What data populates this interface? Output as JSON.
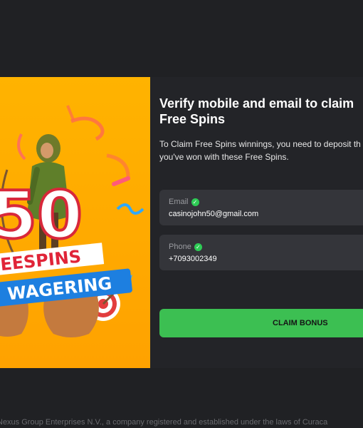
{
  "promo": {
    "number": "50",
    "line1": "EESPINS",
    "line2": "WAGERING"
  },
  "panel": {
    "title": "Verify mobile and email to claim\nFree Spins",
    "description": "To Claim Free Spins winnings, you need to deposit th\nyou've won with these Free Spins.",
    "email": {
      "label": "Email",
      "value": "casinojohn50@gmail.com",
      "icon": "check-circle-icon"
    },
    "phone": {
      "label": "Phone",
      "value": "+7093002349",
      "icon": "check-circle-icon"
    },
    "claim_label": "CLAIM BONUS"
  },
  "footer": {
    "text": "Nexus Group Enterprises N.V., a company registered and established under the laws of Curaca"
  },
  "colors": {
    "background": "#202124",
    "panel": "#232428",
    "field": "#34353a",
    "accent_green": "#3cbf52",
    "promo_orange": "#ffa800"
  }
}
